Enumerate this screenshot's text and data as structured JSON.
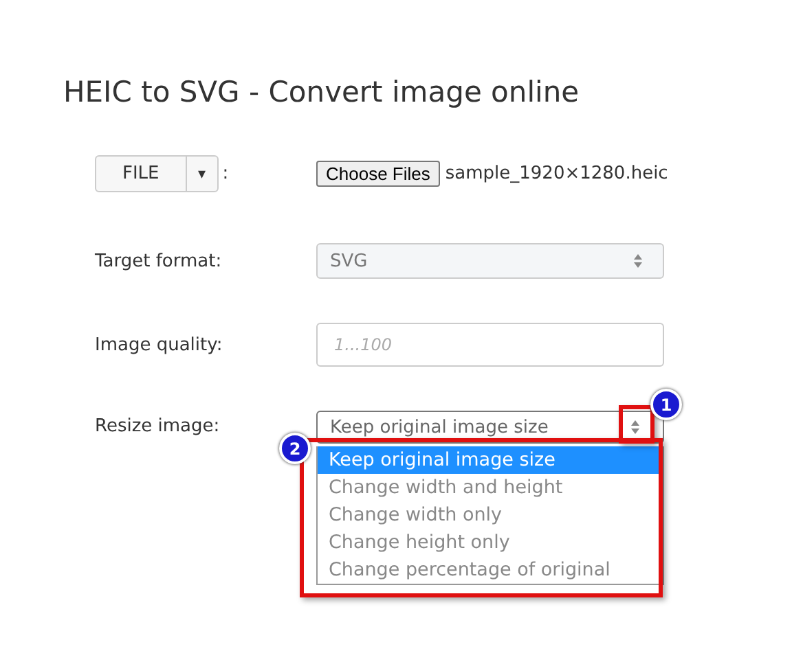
{
  "title": "HEIC to SVG - Convert image online",
  "file_row": {
    "button": "FILE",
    "caret": "▾",
    "colon": ":",
    "choose": "Choose Files",
    "filename": "sample_1920×1280.heic"
  },
  "target_format": {
    "label": "Target format:",
    "value": "SVG",
    "disabled": true
  },
  "image_quality": {
    "label": "Image quality:",
    "placeholder": "1...100"
  },
  "resize": {
    "label": "Resize image:",
    "value": "Keep original image size",
    "options": [
      {
        "label": "Keep original image size",
        "selected": true
      },
      {
        "label": "Change width and height",
        "selected": false
      },
      {
        "label": "Change width only",
        "selected": false
      },
      {
        "label": "Change height only",
        "selected": false
      },
      {
        "label": "Change percentage of original",
        "selected": false
      }
    ]
  },
  "annotations": [
    {
      "number": "1",
      "kind": "arrows"
    },
    {
      "number": "2",
      "kind": "list"
    }
  ]
}
